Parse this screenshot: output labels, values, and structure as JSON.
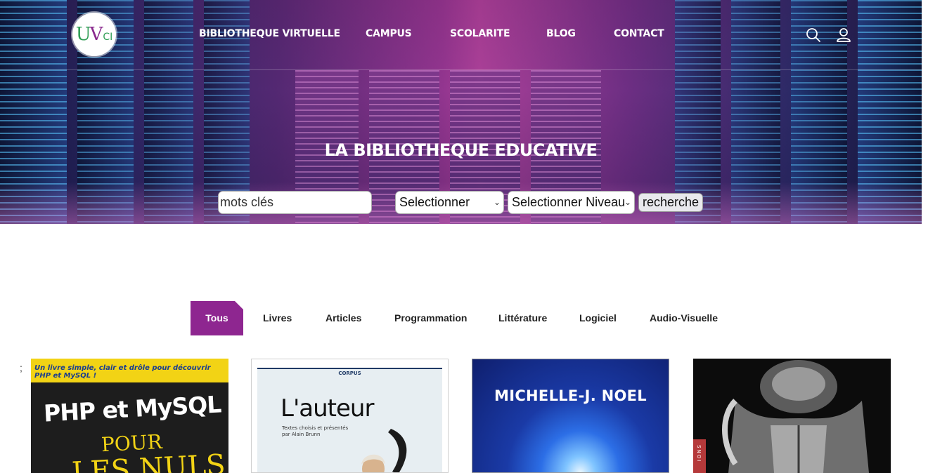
{
  "header": {
    "logo_alt": "UVCI",
    "logo_parts": {
      "u": "U",
      "v": "V",
      "ci": "CI"
    },
    "nav": [
      {
        "label": "BIBLIOTHEQUE VIRTUELLE"
      },
      {
        "label": "CAMPUS"
      },
      {
        "label": "SCOLARITE"
      },
      {
        "label": "BLOG"
      },
      {
        "label": "CONTACT"
      }
    ],
    "icons": [
      "search-icon",
      "user-icon"
    ]
  },
  "hero": {
    "title": "LA BIBLIOTHEQUE EDUCATIVE",
    "search_value": "mots clés",
    "select_category": "Selectionner",
    "select_level": "Selectionner Niveau",
    "search_button": "recherche"
  },
  "filters": {
    "tabs": [
      {
        "label": "Tous",
        "active": true
      },
      {
        "label": "Livres",
        "active": false
      },
      {
        "label": "Articles",
        "active": false
      },
      {
        "label": "Programmation",
        "active": false
      },
      {
        "label": "Littérature",
        "active": false
      },
      {
        "label": "Logiciel",
        "active": false
      },
      {
        "label": "Audio-Visuelle",
        "active": false
      }
    ],
    "active_color": "#8e2690"
  },
  "stray_text": ";",
  "books": [
    {
      "banner": "Un livre simple, clair et drôle pour découvrir PHP et MySQL !",
      "title": "PHP et MySQL",
      "subtitle": "POUR",
      "series": "LES NULS"
    },
    {
      "publisher": "CORPUS",
      "title": "L'auteur",
      "subtitle_line1": "Textes choisis et présentés",
      "subtitle_line2": "par Alain Brunn"
    },
    {
      "author": "MICHELLE-J. NOEL"
    },
    {
      "spine": "IONS"
    }
  ]
}
